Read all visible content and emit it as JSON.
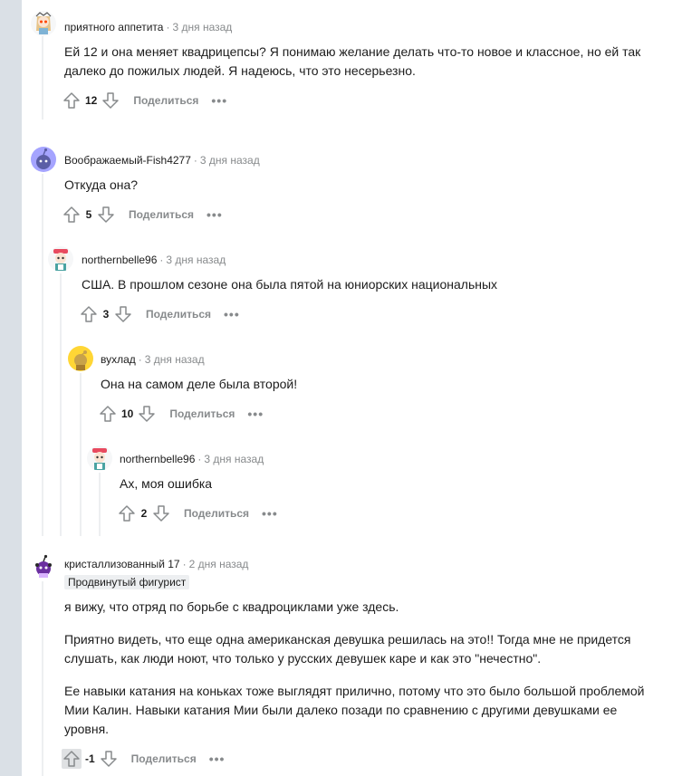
{
  "comments": [
    {
      "username": "приятного аппетита",
      "time": "3 дня назад",
      "body": "Ей 12 и она меняет квадрицепсы? Я понимаю желание делать что-то новое и классное, но ей так далеко до пожилых людей. Я надеюсь, что это несерьезно.",
      "score": "12",
      "share": "Поделиться",
      "more": "•••"
    },
    {
      "username": "Воображаемый-Fish4277",
      "time": "3 дня назад",
      "body": "Откуда она?",
      "score": "5",
      "share": "Поделиться",
      "more": "•••"
    },
    {
      "username": "northernbelle96",
      "time": "3 дня назад",
      "body": "США. В прошлом сезоне она была пятой на юниорских национальных",
      "score": "3",
      "share": "Поделиться",
      "more": "•••"
    },
    {
      "username": "вухлад",
      "time": "3 дня назад",
      "body": "Она на самом деле была второй!",
      "score": "10",
      "share": "Поделиться",
      "more": "•••"
    },
    {
      "username": "northernbelle96",
      "time": "3 дня назад",
      "body": "Ах, моя ошибка",
      "score": "2",
      "share": "Поделиться",
      "more": "•••"
    },
    {
      "username": "кристаллизованный 17",
      "time": "2 дня назад",
      "flair": "Продвинутый фигурист",
      "paragraphs": [
        "я вижу, что отряд по борьбе с квадроциклами уже здесь.",
        "Приятно видеть, что еще одна американская девушка решилась на это!! Тогда мне не придется слушать, как люди ноют, что только у русских девушек каре и как это \"нечестно\".",
        "Ее навыки катания на коньках тоже выглядят прилично, потому что это было большой проблемой Мии Калин. Навыки катания Мии были далеко позади по сравнению с другими девушками ее уровня."
      ],
      "score": "-1",
      "share": "Поделиться",
      "more": "•••"
    }
  ],
  "dot": "·",
  "colors": {
    "background": "#ffffff",
    "side_band": "#dae0e6",
    "thread_line": "#edeff1",
    "meta_text": "#878a8c"
  }
}
